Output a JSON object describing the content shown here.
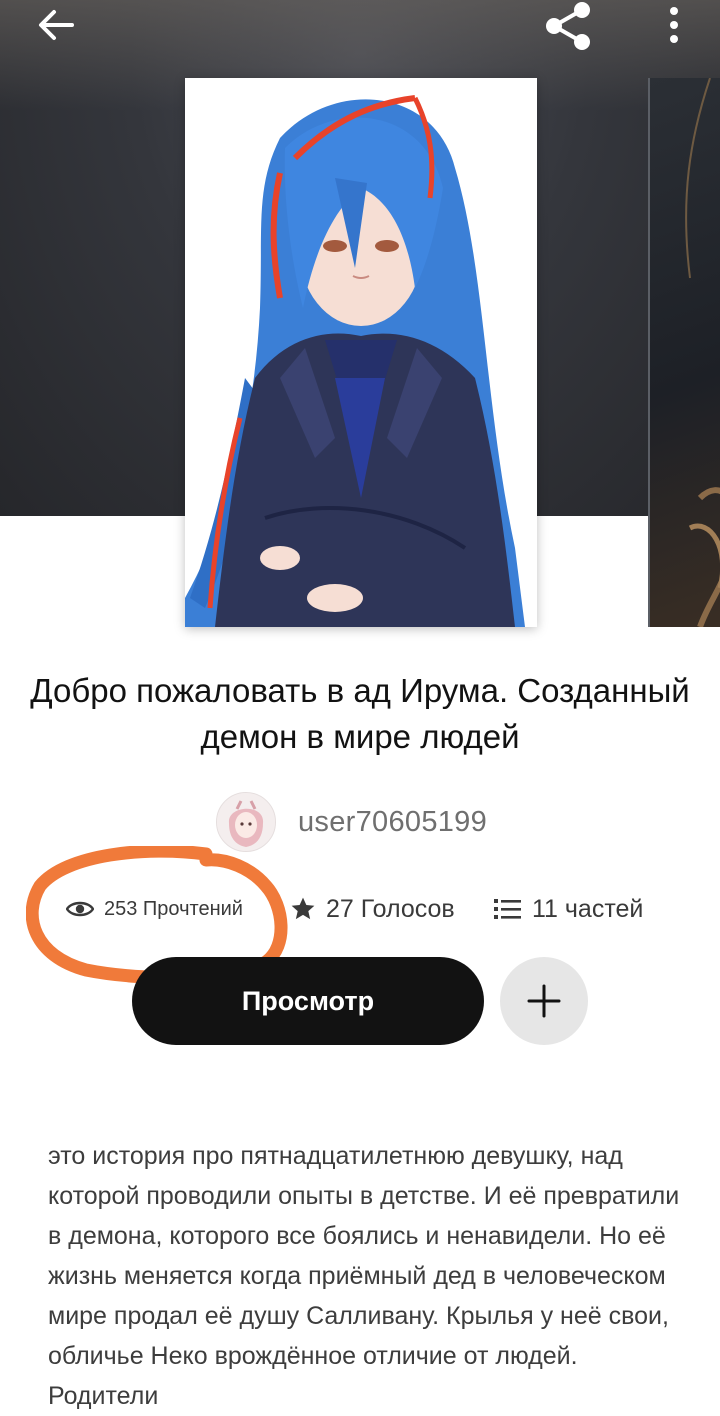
{
  "story": {
    "title": "Добро пожаловать в ад Ирума. Созданный демон в мире людей",
    "author": "user70605199"
  },
  "stats": {
    "reads": "253 Прочтений",
    "votes": "27 Голосов",
    "parts": "11 частей"
  },
  "actions": {
    "view_label": "Просмотр"
  },
  "description": "это история про пятнадцатилетнюю девушку, над которой проводили опыты в детстве. И её превратили в демона, которого все боялись и ненавидели. Но её жизнь меняется когда приёмный дед в человеческом мире продал её душу Салливану. Крылья у неё свои, обличье Неко врождённое отличие от людей. Родители",
  "icons": {
    "back": "arrow-left-icon",
    "share": "share-icon",
    "more": "more-vertical-icon",
    "reads": "eye-icon",
    "votes": "star-icon",
    "parts": "list-icon",
    "add": "plus-icon"
  },
  "colors": {
    "primary_button": "#121212",
    "annotation": "#f07a3a"
  }
}
